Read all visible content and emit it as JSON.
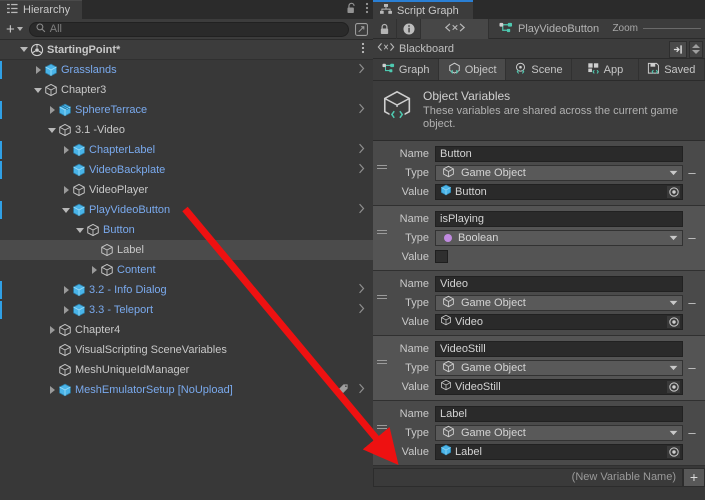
{
  "hierarchy": {
    "tab_label": "Hierarchy",
    "tab_icon": "hierarchy-icon",
    "lock_icon": "lock-open-icon",
    "menu_icon": "kebab-menu-icon",
    "toolbar": {
      "add_label": "+",
      "search_placeholder": "All",
      "search_value": "",
      "search_icon": "search-icon",
      "expand_icon": "expand-window-icon"
    },
    "rows": [
      {
        "label": "StartingPoint*",
        "depth": 0,
        "twisty": "down",
        "icon": "scene-icon",
        "style": "root",
        "marker": false,
        "chevron": false,
        "kebab": true,
        "tag": false,
        "selected": false
      },
      {
        "label": "Grasslands",
        "depth": 1,
        "twisty": "right",
        "icon": "prefab-cube",
        "style": "prefab",
        "marker": true,
        "chevron": true,
        "kebab": false,
        "tag": false,
        "selected": false
      },
      {
        "label": "Chapter3",
        "depth": 1,
        "twisty": "down",
        "icon": "game-object",
        "style": "plain",
        "marker": false,
        "chevron": false,
        "kebab": false,
        "tag": false,
        "selected": false
      },
      {
        "label": "SphereTerrace",
        "depth": 2,
        "twisty": "right",
        "icon": "prefab-model",
        "style": "prefab",
        "marker": true,
        "chevron": true,
        "kebab": false,
        "tag": false,
        "selected": false
      },
      {
        "label": "3.1 -Video",
        "depth": 2,
        "twisty": "down",
        "icon": "game-object",
        "style": "plain",
        "marker": false,
        "chevron": false,
        "kebab": false,
        "tag": false,
        "selected": false
      },
      {
        "label": "ChapterLabel",
        "depth": 3,
        "twisty": "right",
        "icon": "prefab-cube",
        "style": "prefab",
        "marker": true,
        "chevron": true,
        "kebab": false,
        "tag": false,
        "selected": false
      },
      {
        "label": "VideoBackplate",
        "depth": 3,
        "twisty": "none",
        "icon": "prefab-cube",
        "style": "prefab",
        "marker": true,
        "chevron": true,
        "kebab": false,
        "tag": false,
        "selected": false
      },
      {
        "label": "VideoPlayer",
        "depth": 3,
        "twisty": "right",
        "icon": "game-object",
        "style": "plain",
        "marker": false,
        "chevron": false,
        "kebab": false,
        "tag": false,
        "selected": false
      },
      {
        "label": "PlayVideoButton",
        "depth": 3,
        "twisty": "down",
        "icon": "prefab-cube",
        "style": "prefab",
        "marker": true,
        "chevron": true,
        "kebab": false,
        "tag": false,
        "selected": false
      },
      {
        "label": "Button",
        "depth": 4,
        "twisty": "down",
        "icon": "game-object",
        "style": "prefab",
        "marker": false,
        "chevron": false,
        "kebab": false,
        "tag": false,
        "selected": false
      },
      {
        "label": "Label",
        "depth": 5,
        "twisty": "none",
        "icon": "game-object",
        "style": "plain",
        "marker": false,
        "chevron": false,
        "kebab": false,
        "tag": false,
        "selected": true
      },
      {
        "label": "Content",
        "depth": 5,
        "twisty": "right",
        "icon": "game-object",
        "style": "prefab",
        "marker": false,
        "chevron": false,
        "kebab": false,
        "tag": false,
        "selected": false
      },
      {
        "label": "3.2 - Info Dialog",
        "depth": 3,
        "twisty": "right",
        "icon": "prefab-cube",
        "style": "prefab",
        "marker": true,
        "chevron": true,
        "kebab": false,
        "tag": false,
        "selected": false
      },
      {
        "label": "3.3 - Teleport",
        "depth": 3,
        "twisty": "right",
        "icon": "prefab-cube",
        "style": "prefab",
        "marker": true,
        "chevron": true,
        "kebab": false,
        "tag": false,
        "selected": false
      },
      {
        "label": "Chapter4",
        "depth": 2,
        "twisty": "right",
        "icon": "game-object",
        "style": "plain",
        "marker": false,
        "chevron": false,
        "kebab": false,
        "tag": false,
        "selected": false
      },
      {
        "label": "VisualScripting SceneVariables",
        "depth": 2,
        "twisty": "none",
        "icon": "game-object",
        "style": "plain",
        "marker": false,
        "chevron": false,
        "kebab": false,
        "tag": false,
        "selected": false
      },
      {
        "label": "MeshUniqueIdManager",
        "depth": 2,
        "twisty": "none",
        "icon": "game-object",
        "style": "plain",
        "marker": false,
        "chevron": false,
        "kebab": false,
        "tag": false,
        "selected": false
      },
      {
        "label": "MeshEmulatorSetup [NoUpload]",
        "depth": 2,
        "twisty": "right",
        "icon": "prefab-cube",
        "style": "prefab",
        "marker": false,
        "chevron": true,
        "kebab": false,
        "tag": true,
        "selected": false
      }
    ]
  },
  "script_graph": {
    "tab_label": "Script Graph",
    "tab_icon": "script-graph-icon",
    "toolbar": {
      "lock_icon": "lock-closed-icon",
      "info_icon": "info-icon",
      "code_icon": "angle-brackets-icon",
      "breadcrumb_icon": "graph-node-icon",
      "breadcrumb_label": "PlayVideoButton",
      "zoom_label": "Zoom"
    },
    "blackboard": {
      "icon": "angle-brackets-icon",
      "label": "Blackboard",
      "panel_toggle_icon": "panel-toggle-icon",
      "stepper_icon": "stepper-icon"
    },
    "subtabs": [
      {
        "label": "Graph",
        "icon": "graph-icon",
        "active": false
      },
      {
        "label": "Object",
        "icon": "object-icon",
        "active": true
      },
      {
        "label": "Scene",
        "icon": "scene-icon",
        "active": false
      },
      {
        "label": "App",
        "icon": "app-icon",
        "active": false
      },
      {
        "label": "Saved",
        "icon": "save-icon",
        "active": false
      }
    ],
    "header": {
      "icon": "object-variables-icon",
      "title": "Object Variables",
      "description": "These variables are shared across the current game object."
    },
    "labels": {
      "name": "Name",
      "type": "Type",
      "value": "Value",
      "remove": "–"
    },
    "variables": [
      {
        "name": "Button",
        "type": "Game Object",
        "type_icon": "game-object-icon",
        "value": "Button",
        "value_icon": "prefab-cube-icon",
        "value_kind": "object"
      },
      {
        "name": "isPlaying",
        "type": "Boolean",
        "type_icon": "boolean-dot-icon",
        "value": "",
        "value_icon": "",
        "value_kind": "boolean"
      },
      {
        "name": "Video",
        "type": "Game Object",
        "type_icon": "game-object-icon",
        "value": "Video",
        "value_icon": "game-object-icon",
        "value_kind": "object"
      },
      {
        "name": "VideoStill",
        "type": "Game Object",
        "type_icon": "game-object-icon",
        "value": "VideoStill",
        "value_icon": "game-object-icon",
        "value_kind": "object"
      },
      {
        "name": "Label",
        "type": "Game Object",
        "type_icon": "game-object-icon",
        "value": "Label",
        "value_icon": "prefab-cube-icon",
        "value_kind": "object"
      }
    ],
    "new_variable": {
      "placeholder": "(New Variable Name)",
      "add_label": "+"
    }
  },
  "annotation": {
    "arrow_color": "#ee1111",
    "arrow_from": "Label (hierarchy)",
    "arrow_to": "Label variable Value field"
  },
  "colors": {
    "panel_bg": "#383838",
    "toolbar_bg": "#3c3c3c",
    "row_selected": "#4b4b4b",
    "prefab_blue": "#7aaaee",
    "accent_cyan": "#4ec9b0",
    "tab_accent": "#2a7fd4",
    "field_bg": "#2a2a2a",
    "var_block": "#4a4a4a",
    "var_block_alt": "#545454",
    "marker_blue": "#30a0e6",
    "boolean_purple": "#c08ae0"
  }
}
